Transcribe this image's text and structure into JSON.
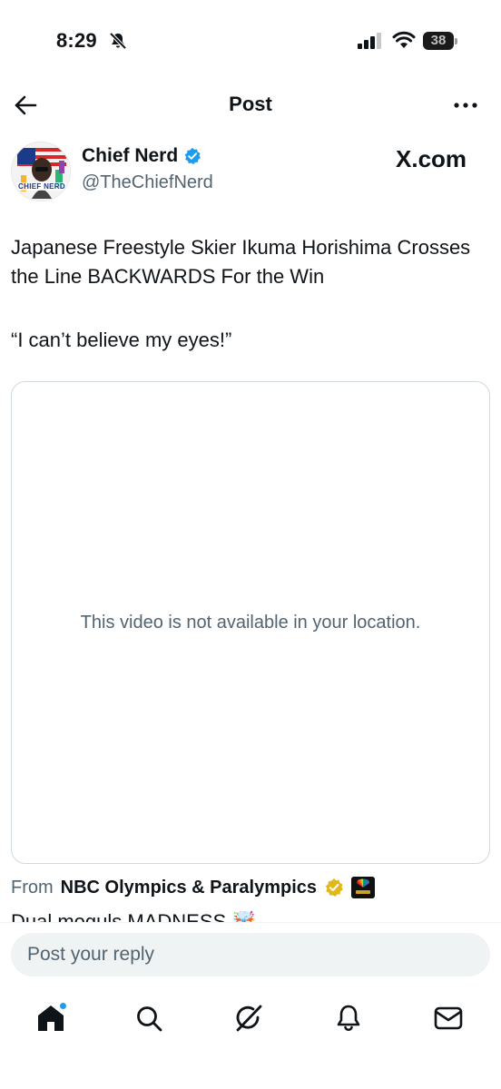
{
  "status_bar": {
    "time": "8:29",
    "battery_level": "38",
    "icons": [
      "bell-slash-icon",
      "cellular-signal-icon",
      "wifi-icon",
      "battery-icon"
    ]
  },
  "nav": {
    "title": "Post",
    "back_icon": "arrow-left-icon",
    "more_icon": "more-horizontal-icon"
  },
  "author": {
    "name": "Chief Nerd",
    "handle": "@TheChiefNerd",
    "verified": true,
    "avatar_text": "CHIEF NERD",
    "source_site": "X.com"
  },
  "post": {
    "text": "Japanese Freestyle Skier Ikuma Horishima Crosses the Line BACKWARDS For the Win",
    "quote": "“I can’t believe my eyes!”",
    "video_message": "This video is not available in your location."
  },
  "from": {
    "label": "From",
    "source": "NBC Olympics & Paralympics",
    "badge": "gold-verified-icon",
    "logo": "nbc-sports-logo-icon"
  },
  "truncated_line": "Dual moguls MADNESS 🤯",
  "reply": {
    "placeholder": "Post your reply"
  },
  "tabbar": {
    "items": [
      "home-icon",
      "search-icon",
      "grok-icon",
      "notifications-icon",
      "messages-icon"
    ],
    "active": "home-icon"
  },
  "colors": {
    "text": "#0f1419",
    "secondary": "#536471",
    "accent": "#1d9bf0",
    "border": "#cfd9de",
    "input_bg": "#eff3f4"
  }
}
